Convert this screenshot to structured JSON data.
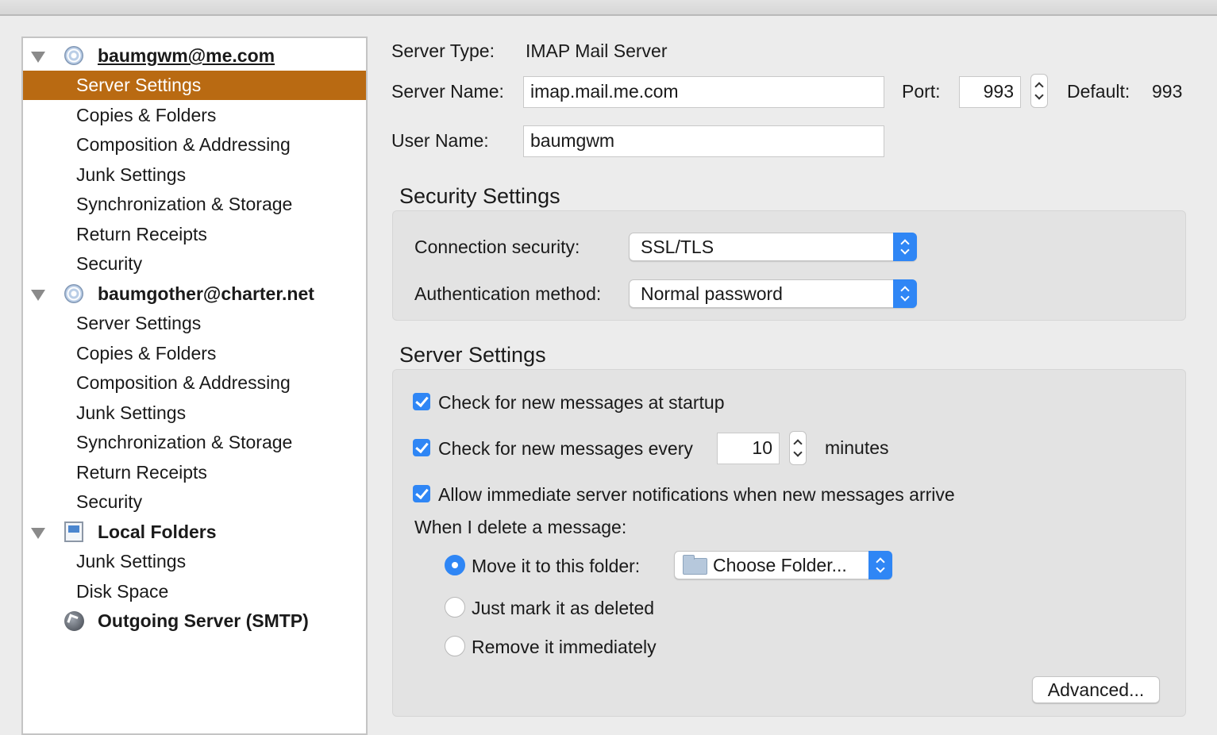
{
  "sidebar": {
    "accounts": [
      {
        "name": "baumgwm@me.com",
        "items": [
          "Server Settings",
          "Copies & Folders",
          "Composition & Addressing",
          "Junk Settings",
          "Synchronization & Storage",
          "Return Receipts",
          "Security"
        ]
      },
      {
        "name": "baumgother@charter.net",
        "items": [
          "Server Settings",
          "Copies & Folders",
          "Composition & Addressing",
          "Junk Settings",
          "Synchronization & Storage",
          "Return Receipts",
          "Security"
        ]
      },
      {
        "name": "Local Folders",
        "items": [
          "Junk Settings",
          "Disk Space"
        ]
      }
    ],
    "outgoing": "Outgoing Server (SMTP)",
    "selected": "baumgwm@me.com / Server Settings"
  },
  "server": {
    "type_label": "Server Type:",
    "type_value": "IMAP Mail Server",
    "name_label": "Server Name:",
    "name_value": "imap.mail.me.com",
    "port_label": "Port:",
    "port_value": "993",
    "default_label": "Default:",
    "default_value": "993",
    "user_label": "User Name:",
    "user_value": "baumgwm"
  },
  "security": {
    "title": "Security Settings",
    "connection_label": "Connection security:",
    "connection_value": "SSL/TLS",
    "auth_label": "Authentication method:",
    "auth_value": "Normal password"
  },
  "settings": {
    "title": "Server Settings",
    "check_startup": "Check for new messages at startup",
    "check_every": "Check for new messages every",
    "check_every_value": "10",
    "minutes": "minutes",
    "allow_notifications": "Allow immediate server notifications when new messages arrive",
    "delete_label": "When I delete a message:",
    "move_option": "Move it to this folder:",
    "folder_value": "Choose Folder...",
    "mark_option": "Just mark it as deleted",
    "remove_option": "Remove it immediately",
    "advanced_button": "Advanced..."
  },
  "colors": {
    "selection": "#b96a12",
    "accent": "#2f86f5"
  }
}
